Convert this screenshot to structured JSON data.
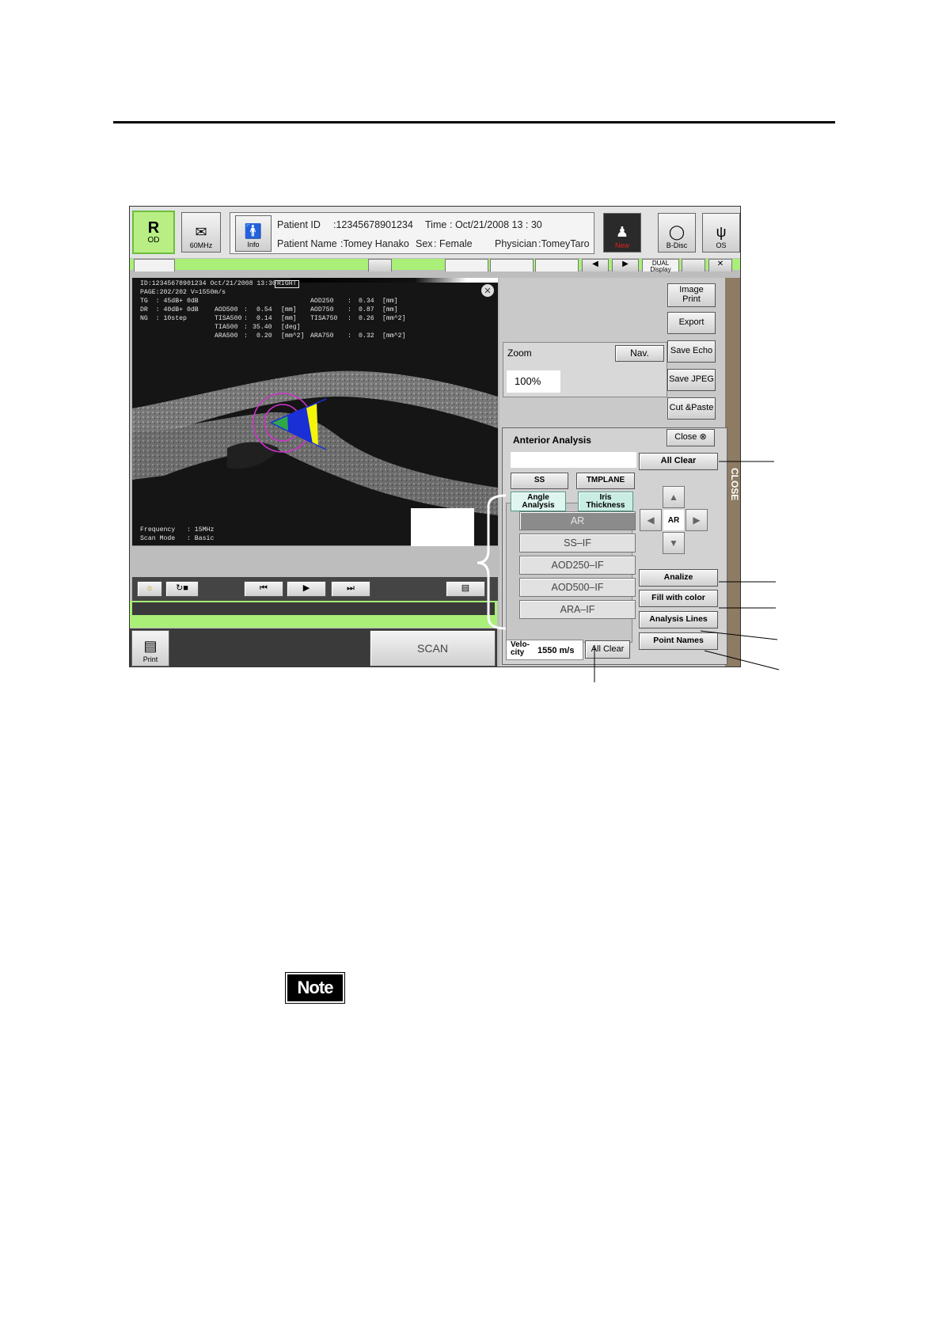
{
  "toolbar": {
    "eye_right": {
      "glyph": "R",
      "label": "OD"
    },
    "probe": {
      "label": "60MHz"
    },
    "info_button": "Info",
    "patient_id_label": "Patient ID",
    "patient_id_value": ":12345678901234",
    "time_label": "Time",
    "time_value": ": Oct/21/2008  13 : 30",
    "patient_name_label": "Patient Name",
    "patient_name_value": ":Tomey Hanako",
    "sex_label": "Sex",
    "sex_value": ": Female",
    "physician_label": "Physician",
    "physician_value": ":TomeyTaro",
    "new_button": "New",
    "bdisc_button": "B-Disc",
    "eye_left": "OS"
  },
  "tab_row": {
    "dual_display": "DUAL\nDisplay"
  },
  "overlay": {
    "header_line": "ID:12345678901234 Oct/21/2008 13:30",
    "side_badge": "RIGHT",
    "page_line": "PAGE:202/202 V=1550m/s",
    "tg": "TG  : 45dB+ 0dB",
    "dr": "DR  : 40dB+ 0dB",
    "ng": "NG  : 10step",
    "measurements": [
      {
        "name": "AOD250",
        "value": "0.34",
        "unit": "[mm]"
      },
      {
        "name": "AOD500",
        "value": "0.54",
        "unit": "[mm]"
      },
      {
        "name": "AOD750",
        "value": "0.87",
        "unit": "[mm]"
      },
      {
        "name": "TISA500",
        "value": "0.14",
        "unit": "[mm]"
      },
      {
        "name": "TISA750",
        "value": "0.26",
        "unit": "[mm^2]"
      },
      {
        "name": "TIA500",
        "value": "35.40",
        "unit": "[deg]"
      },
      {
        "name": "ARA500",
        "value": "0.20",
        "unit": "[mm^2]"
      },
      {
        "name": "ARA750",
        "value": "0.32",
        "unit": "[mm^2]"
      }
    ],
    "frequency": "Frequency   : 15MHz",
    "scan_mode": "Scan Mode   : Basic"
  },
  "right_buttons": {
    "image_print": "Image\nPrint",
    "export": "Export",
    "save_echo": "Save Echo",
    "save_jpeg": "Save JPEG",
    "cut_paste": "Cut &Paste"
  },
  "zoom": {
    "label": "Zoom",
    "nav": "Nav.",
    "value": "100%"
  },
  "close_tab": "CLOSE",
  "anterior": {
    "title": "Anterior Analysis",
    "close_button": "Close",
    "all_clear_top": "All Clear",
    "ss_button": "SS",
    "tmplane_button": "TMPLANE",
    "tab_angle": "Angle\nAnalysis",
    "tab_iris": "Iris\nThickness",
    "items": [
      "AR",
      "SS–IF",
      "AOD250–IF",
      "AOD500–IF",
      "ARA–IF"
    ],
    "selected_item": "AR",
    "dpad_center": "AR",
    "analize_button": "Analize",
    "fill_button": "Fill with color",
    "lines_button": "Analysis Lines",
    "names_button": "Point Names",
    "velocity_label": "Velo-\ncity",
    "velocity_value": "1550 m/s",
    "all_clear_bottom": "All Clear"
  },
  "bottom": {
    "print": "Print",
    "scan": "SCAN"
  },
  "note_label": "Note",
  "colors": {
    "green_bar": "#a9ef78",
    "od_green": "#b8ee83",
    "magenta": "#cc33cc",
    "fill_blue": "#1a2fd6",
    "fill_yellow": "#f5f50a",
    "fill_green": "#2fa84a",
    "close_brown": "#8d7b63"
  }
}
